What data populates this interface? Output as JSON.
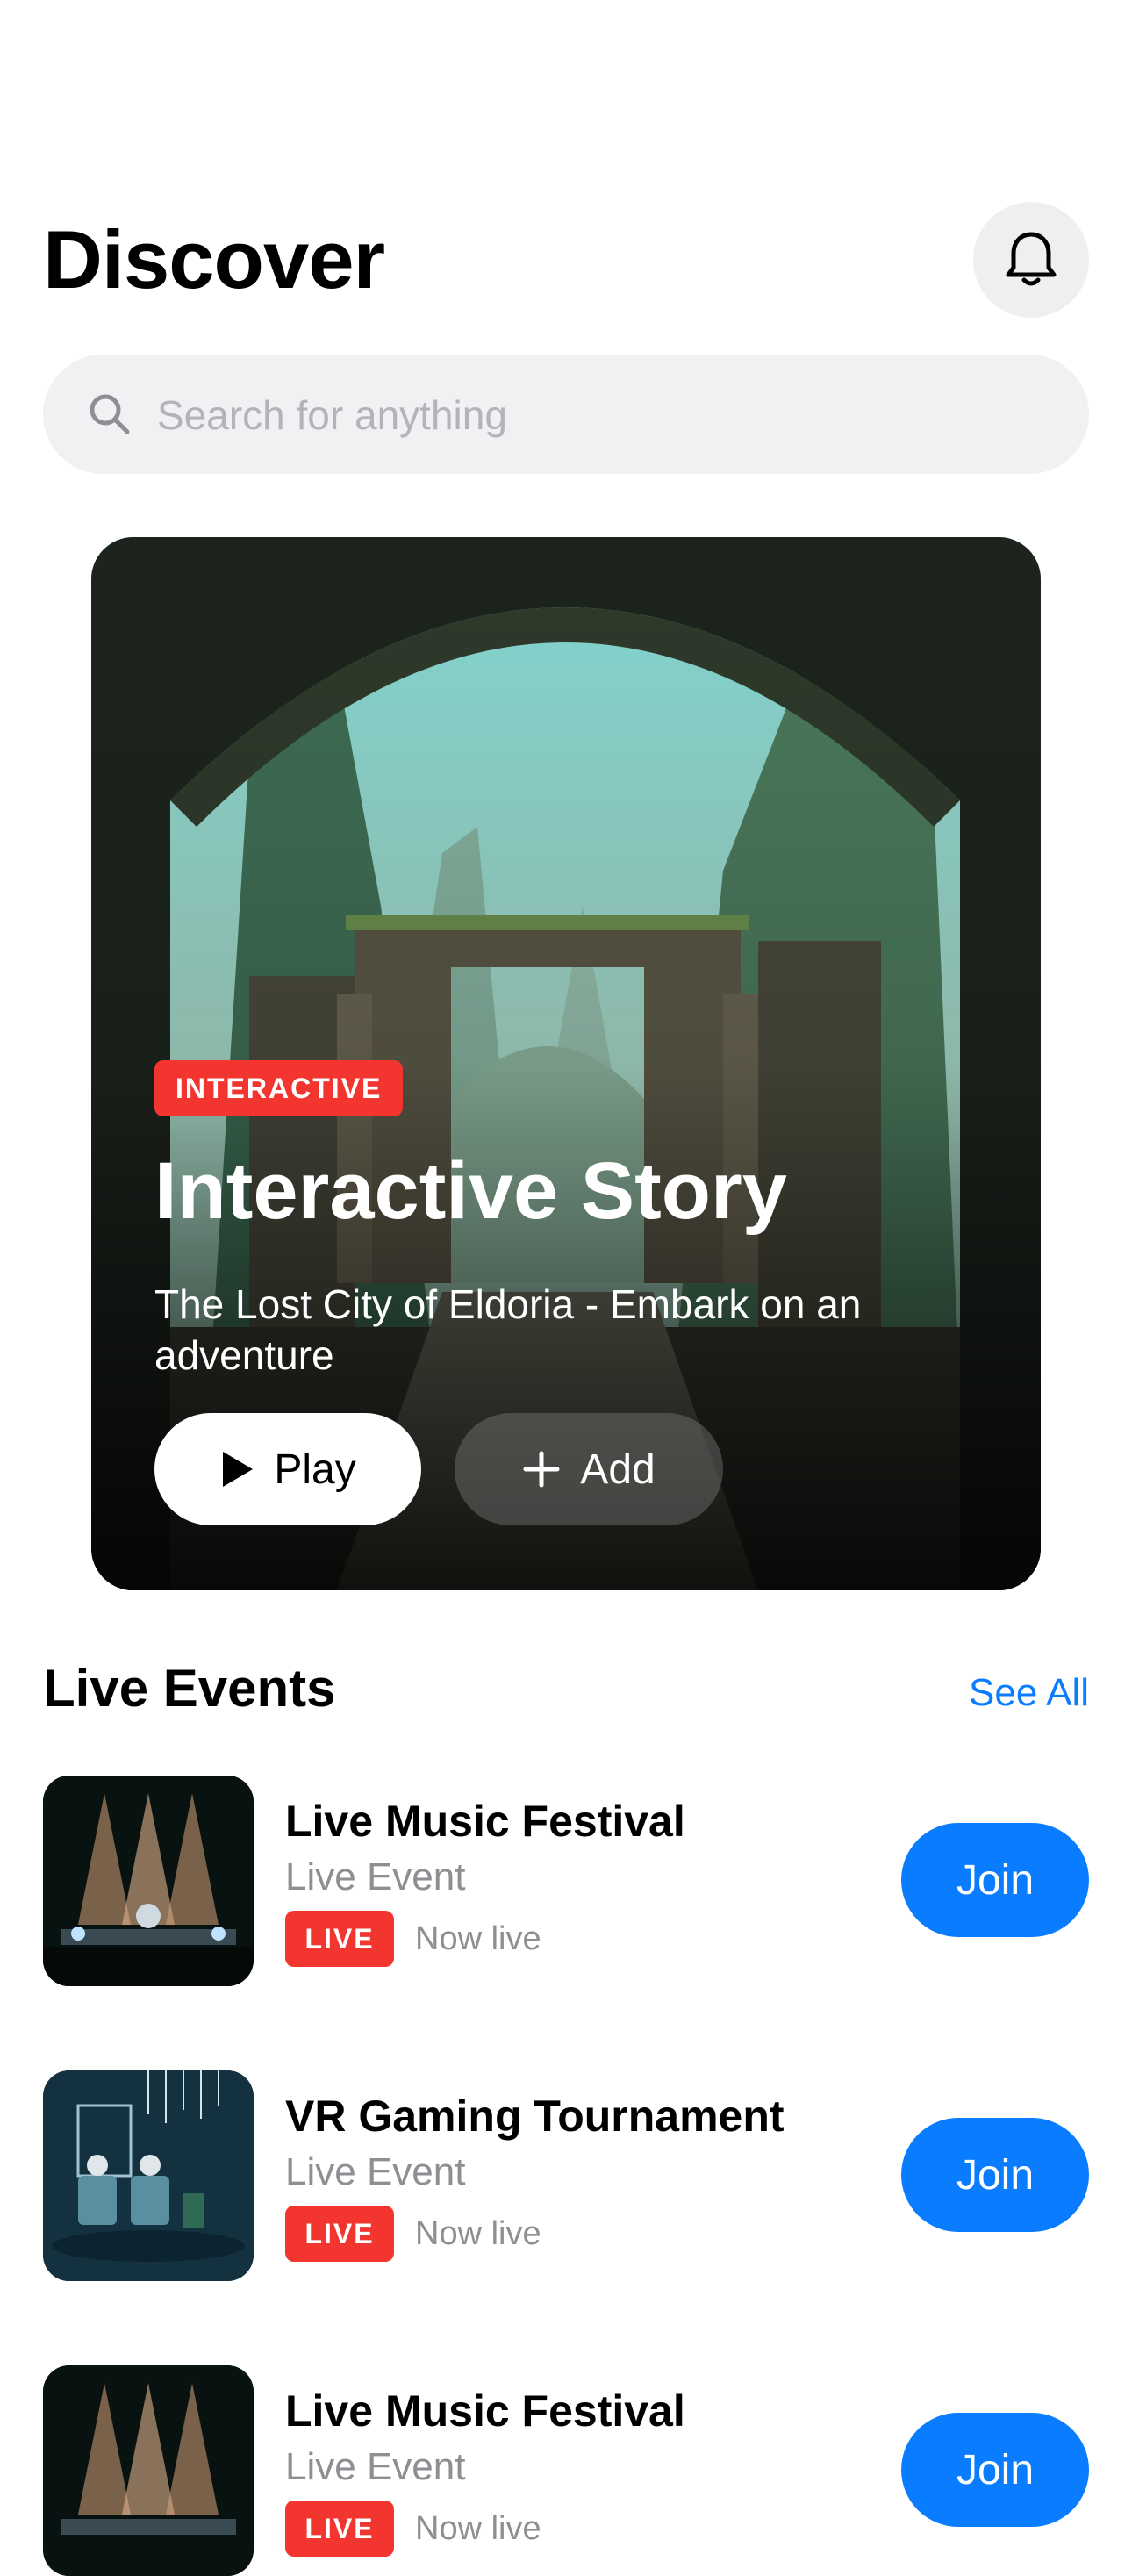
{
  "header": {
    "title": "Discover",
    "notifications_icon": "bell-icon"
  },
  "search": {
    "placeholder": "Search for anything",
    "icon": "search-icon"
  },
  "featured": {
    "badge": "INTERACTIVE",
    "title": "Interactive Story",
    "subtitle": "The Lost City of Eldoria - Embark on an adventure",
    "play_label": "Play",
    "add_label": "Add",
    "play_icon": "play-icon",
    "add_icon": "plus-icon"
  },
  "live_events": {
    "title": "Live Events",
    "see_all": "See All",
    "items": [
      {
        "title": "Live Music Festival",
        "subtitle": "Live Event",
        "badge": "LIVE",
        "status": "Now live",
        "action": "Join"
      },
      {
        "title": "VR Gaming Tournament",
        "subtitle": "Live Event",
        "badge": "LIVE",
        "status": "Now live",
        "action": "Join"
      },
      {
        "title": "Live Music Festival",
        "subtitle": "Live Event",
        "badge": "LIVE",
        "status": "Now live",
        "action": "Join"
      }
    ]
  },
  "colors": {
    "accent": "#0a7cff",
    "live": "#f2352e",
    "search_bg": "#f1f1f4"
  }
}
